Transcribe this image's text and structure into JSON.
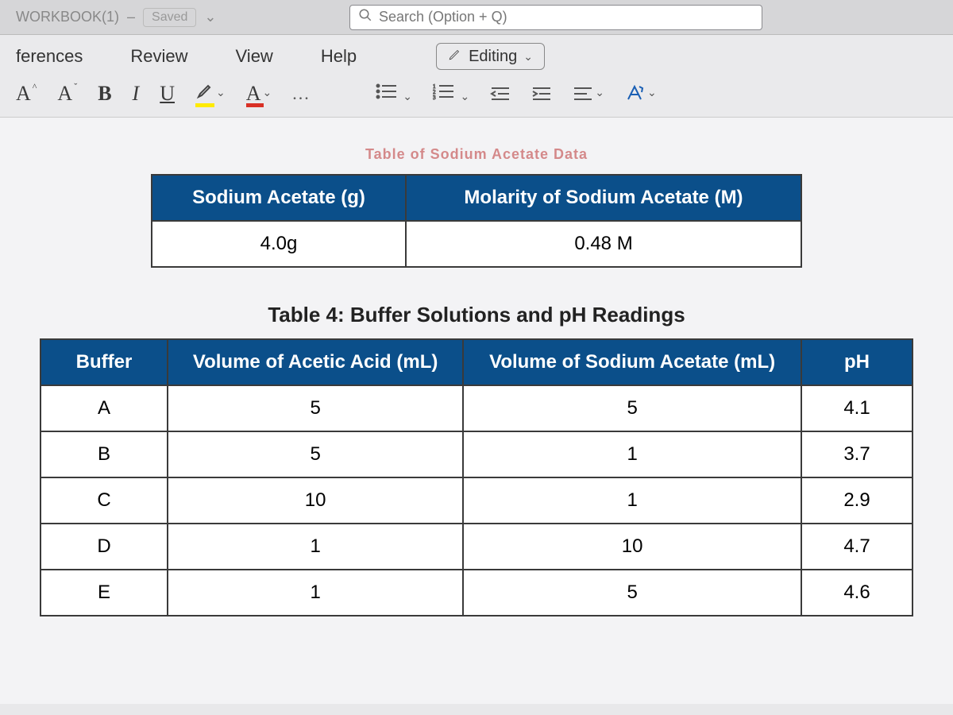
{
  "topbar": {
    "doc_title_fragment": "WORKBOOK(1)",
    "saved_label": "Saved",
    "search_placeholder": "Search (Option + Q)"
  },
  "ribbon": {
    "tabs": [
      "ferences",
      "Review",
      "View",
      "Help"
    ],
    "editing_label": "Editing"
  },
  "toolbar": {
    "inc_font": "A",
    "dec_font": "A",
    "bold": "B",
    "italic": "I",
    "underline": "U",
    "font_color": "A",
    "more": "..."
  },
  "truncated_caption": "Table of Sodium Acetate Data",
  "table1": {
    "headers": [
      "Sodium Acetate (g)",
      "Molarity of Sodium Acetate (M)"
    ],
    "row": [
      "4.0g",
      "0.48 M"
    ]
  },
  "table2": {
    "caption": "Table 4: Buffer Solutions and pH Readings",
    "headers": [
      "Buffer",
      "Volume of Acetic Acid (mL)",
      "Volume of Sodium Acetate (mL)",
      "pH"
    ],
    "rows": [
      {
        "buffer": "A",
        "acetic": "5",
        "acetate": "5",
        "ph": "4.1"
      },
      {
        "buffer": "B",
        "acetic": "5",
        "acetate": "1",
        "ph": "3.7"
      },
      {
        "buffer": "C",
        "acetic": "10",
        "acetate": "1",
        "ph": "2.9"
      },
      {
        "buffer": "D",
        "acetic": "1",
        "acetate": "10",
        "ph": "4.7"
      },
      {
        "buffer": "E",
        "acetic": "1",
        "acetate": "5",
        "ph": "4.6"
      }
    ]
  },
  "chart_data": {
    "type": "table",
    "title": "Table 4: Buffer Solutions and pH Readings",
    "columns": [
      "Buffer",
      "Volume of Acetic Acid (mL)",
      "Volume of Sodium Acetate (mL)",
      "pH"
    ],
    "rows": [
      [
        "A",
        5,
        5,
        4.1
      ],
      [
        "B",
        5,
        1,
        3.7
      ],
      [
        "C",
        10,
        1,
        2.9
      ],
      [
        "D",
        1,
        10,
        4.7
      ],
      [
        "E",
        1,
        5,
        4.6
      ]
    ],
    "aux_table": {
      "title": "Sodium Acetate",
      "columns": [
        "Sodium Acetate (g)",
        "Molarity of Sodium Acetate (M)"
      ],
      "rows": [
        [
          "4.0g",
          "0.48 M"
        ]
      ]
    }
  }
}
